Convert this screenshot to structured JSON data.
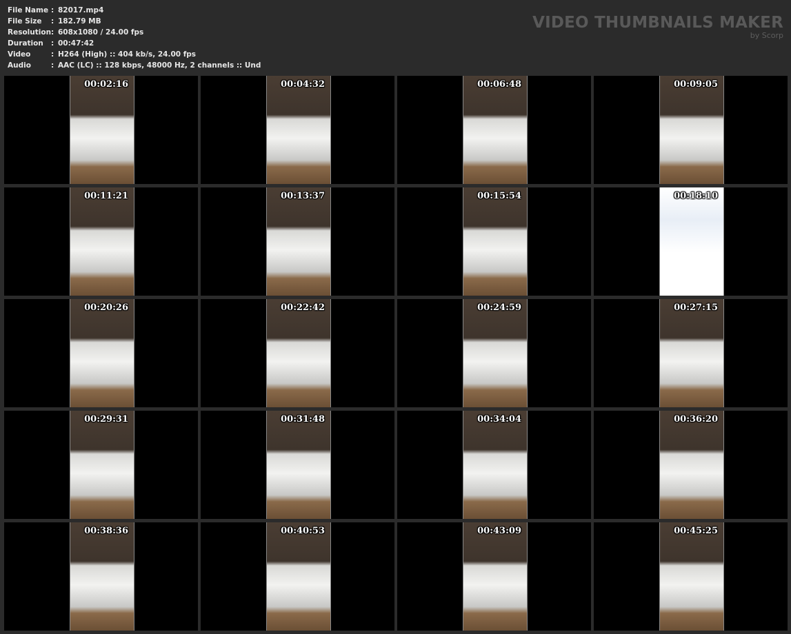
{
  "info": [
    {
      "key": "File Name",
      "value": "82017.mp4"
    },
    {
      "key": "File Size",
      "value": "182.79 MB"
    },
    {
      "key": "Resolution",
      "value": "608x1080 / 24.00 fps"
    },
    {
      "key": "Duration",
      "value": "00:47:42"
    },
    {
      "key": "Video",
      "value": "H264 (High) :: 404 kb/s, 24.00 fps"
    },
    {
      "key": "Audio",
      "value": "AAC (LC) :: 128 kbps, 48000 Hz, 2 channels :: Und"
    }
  ],
  "separator": ":",
  "brand": {
    "title": "VIDEO THUMBNAILS MAKER",
    "subtitle": "by Scorp"
  },
  "thumbnails": [
    "00:02:16",
    "00:04:32",
    "00:06:48",
    "00:09:05",
    "00:11:21",
    "00:13:37",
    "00:15:54",
    "00:18:10",
    "00:20:26",
    "00:22:42",
    "00:24:59",
    "00:27:15",
    "00:29:31",
    "00:31:48",
    "00:34:04",
    "00:36:20",
    "00:38:36",
    "00:40:53",
    "00:43:09",
    "00:45:25"
  ],
  "logo_frame_index": 7
}
